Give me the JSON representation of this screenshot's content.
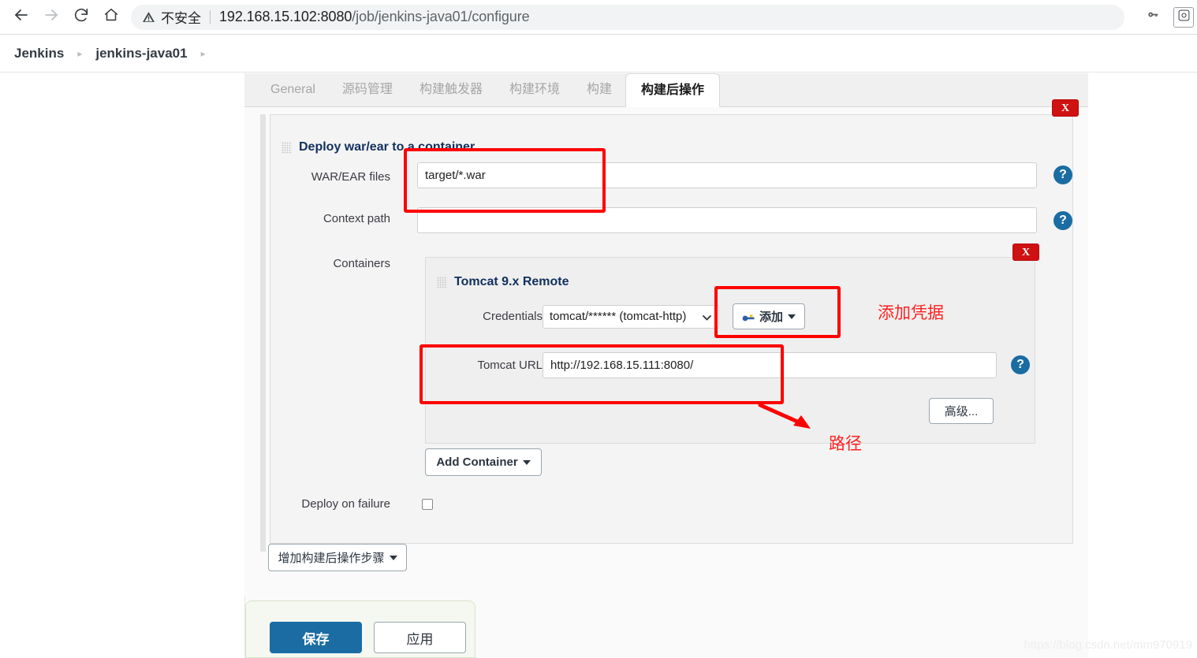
{
  "browser": {
    "back_icon": "arrow-left-icon",
    "forward_icon": "arrow-right-icon",
    "reload_icon": "reload-icon",
    "home_icon": "home-icon",
    "security_warning": "不安全",
    "url_host": "192.168.15.102:8080",
    "url_path": "/job/jenkins-java01/configure",
    "key_icon": "key-icon",
    "extension_icon": "extension-icon"
  },
  "breadcrumb": {
    "items": [
      {
        "label": "Jenkins"
      },
      {
        "label": "jenkins-java01"
      }
    ],
    "separator": "▸"
  },
  "tabs": [
    {
      "label": "General",
      "active": false
    },
    {
      "label": "源码管理",
      "active": false
    },
    {
      "label": "构建触发器",
      "active": false
    },
    {
      "label": "构建环境",
      "active": false
    },
    {
      "label": "构建",
      "active": false
    },
    {
      "label": "构建后操作",
      "active": true
    }
  ],
  "deploy_section": {
    "title": "Deploy war/ear to a container",
    "close_label": "X",
    "rows": {
      "war_label": "WAR/EAR files",
      "war_value": "target/*.war",
      "context_label": "Context path",
      "context_value": "",
      "containers_label": "Containers",
      "deploy_on_failure_label": "Deploy on failure"
    },
    "help_icon": "?",
    "container": {
      "title": "Tomcat 9.x Remote",
      "close_label": "X",
      "credentials_label": "Credentials",
      "credentials_value": "tomcat/****** (tomcat-http)",
      "credentials_caret": "⌄",
      "add_credentials_label": "添加",
      "add_credentials_icon": "key-icon",
      "tomcat_url_label": "Tomcat URL",
      "tomcat_url_value": "http://192.168.15.111:8080/",
      "advanced_label": "高级...",
      "help_icon": "?"
    },
    "add_container_label": "Add Container"
  },
  "actions": {
    "add_post_step_label": "增加构建后操作步骤",
    "save_label": "保存",
    "apply_label": "应用"
  },
  "annotations": [
    {
      "name": "add-credentials-note",
      "text": "添加凭据"
    },
    {
      "name": "path-note",
      "text": "路径"
    }
  ],
  "watermark": "https://blog.csdn.net/mm970919",
  "colors": {
    "accent_blue": "#1a6ca3",
    "annotation_red": "#ff0000",
    "close_red": "#cf1111"
  }
}
